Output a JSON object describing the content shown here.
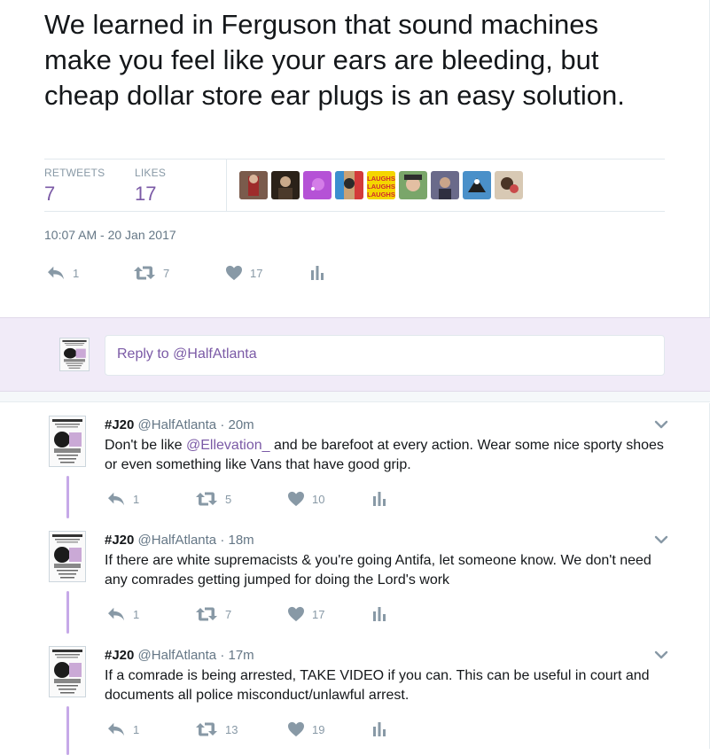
{
  "main_tweet": {
    "text": "We learned in Ferguson that sound machines make you feel like your ears are bleeding, but cheap dollar store ear plugs is an easy solution.",
    "retweets_label": "RETWEETS",
    "retweets_count": "7",
    "likes_label": "LIKES",
    "likes_count": "17",
    "liker_avatar_count": 9,
    "liker_avatar_text": "LAUGHS",
    "timestamp": "10:07 AM - 20 Jan 2017",
    "actions": {
      "reply": "1",
      "retweet": "7",
      "like": "17"
    }
  },
  "reply_box": {
    "placeholder_prefix": "Reply to ",
    "placeholder_handle": "@HalfAtlanta"
  },
  "thread": [
    {
      "name": "#J20",
      "handle": "@HalfAtlanta",
      "dot": "·",
      "time": "20m",
      "text_before": "Don't be like ",
      "mention": "@Ellevation_",
      "text_after": " and be barefoot at every action. Wear some nice sporty shoes or even something like Vans that have good grip.",
      "replies": "1",
      "retweets": "5",
      "likes": "10"
    },
    {
      "name": "#J20",
      "handle": "@HalfAtlanta",
      "dot": "·",
      "time": "18m",
      "text": "If there are white supremacists & you're going Antifa, let someone know. We don't need any comrades getting jumped for doing the Lord's work",
      "replies": "1",
      "retweets": "7",
      "likes": "17"
    },
    {
      "name": "#J20",
      "handle": "@HalfAtlanta",
      "dot": "·",
      "time": "17m",
      "text": "If a comrade is being arrested, TAKE VIDEO if you can. This can be useful in court and documents all police misconduct/unlawful arrest.",
      "replies": "1",
      "retweets": "13",
      "likes": "19"
    }
  ],
  "colors": {
    "accent": "#7b5aa6",
    "thread_line": "#c6a9e8",
    "reply_band": "#f1ebf8",
    "muted": "#8899a6"
  },
  "icons": [
    "reply-icon",
    "retweet-icon",
    "heart-icon",
    "analytics-icon",
    "chevron-down-icon"
  ]
}
